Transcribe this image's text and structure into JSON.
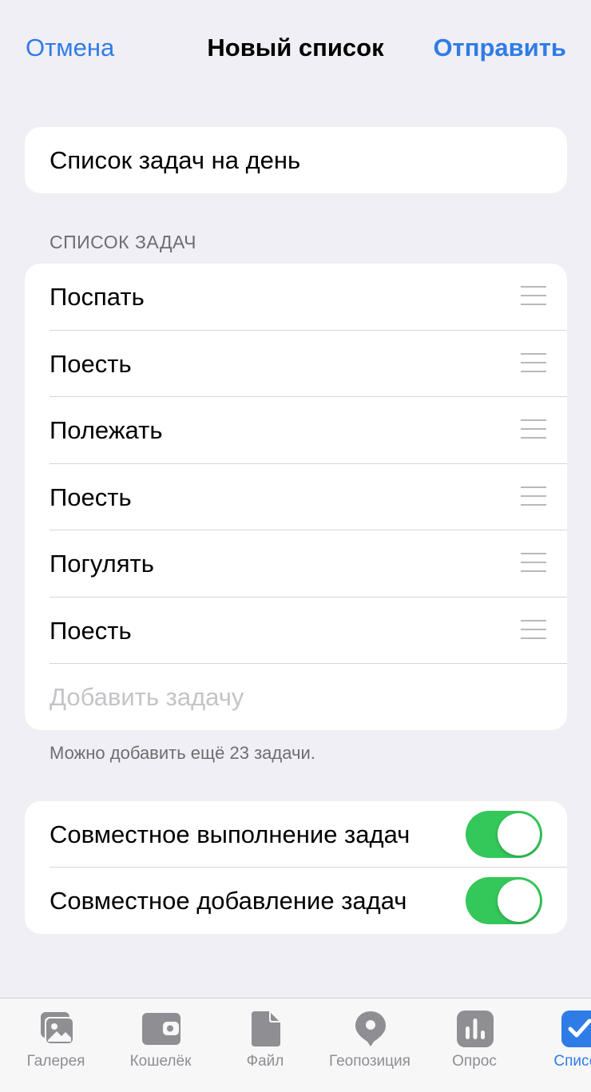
{
  "nav": {
    "cancel_label": "Отмена",
    "title": "Новый список",
    "send_label": "Отправить"
  },
  "list_title": {
    "value": "Список задач на день"
  },
  "tasks_section": {
    "header": "СПИСОК ЗАДАЧ",
    "items": [
      {
        "label": "Поспать"
      },
      {
        "label": "Поесть"
      },
      {
        "label": "Полежать"
      },
      {
        "label": "Поесть"
      },
      {
        "label": "Погулять"
      },
      {
        "label": "Поесть"
      }
    ],
    "add_placeholder": "Добавить задачу",
    "hint": "Можно добавить ещё 23 задачи."
  },
  "settings": {
    "items": [
      {
        "label": "Совместное выполнение задач",
        "enabled": true
      },
      {
        "label": "Совместное добавление задач",
        "enabled": true
      }
    ]
  },
  "tabbar": {
    "items": [
      {
        "label": "Галерея",
        "icon": "gallery-icon",
        "active": false
      },
      {
        "label": "Кошелёк",
        "icon": "wallet-icon",
        "active": false
      },
      {
        "label": "Файл",
        "icon": "file-icon",
        "active": false
      },
      {
        "label": "Геопозиция",
        "icon": "location-pin-icon",
        "active": false
      },
      {
        "label": "Опрос",
        "icon": "poll-icon",
        "active": false
      },
      {
        "label": "Список",
        "icon": "checklist-icon",
        "active": true
      }
    ]
  },
  "colors": {
    "accent": "#2f7ce6",
    "toggle_on": "#34c759",
    "background": "#f0eff5",
    "icon_gray": "#8e8e93"
  }
}
